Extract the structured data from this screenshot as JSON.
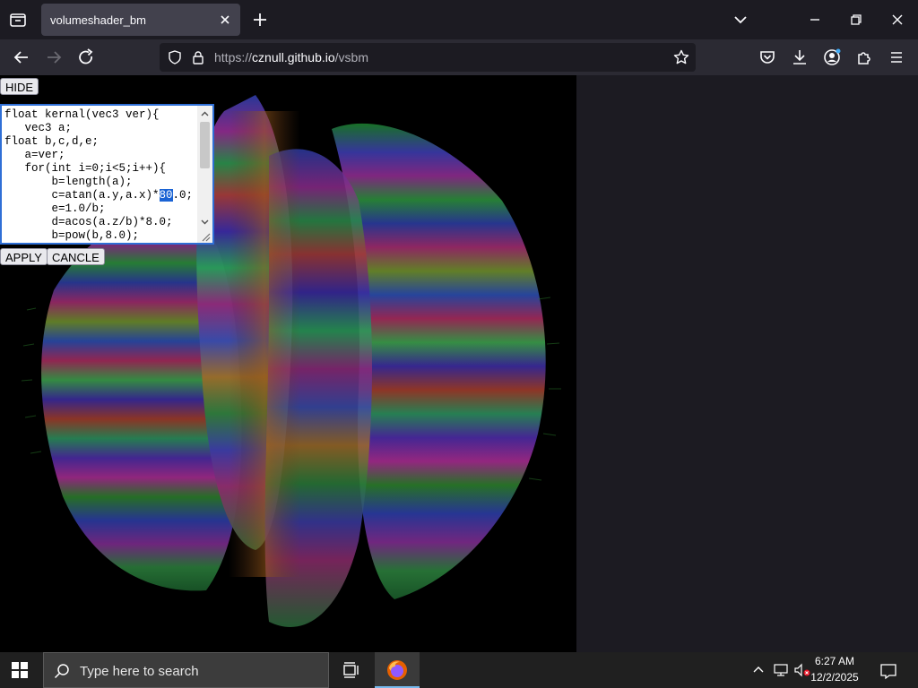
{
  "browser": {
    "tab_title": "volumeshader_bm",
    "url_prefix": "https://",
    "url_host": "cznull.github.io",
    "url_path": "/vsbm"
  },
  "page": {
    "hide_label": "HIDE",
    "apply_label": "APPLY",
    "cancel_label": "CANCLE",
    "code_lines": [
      "float kernal(vec3 ver){",
      "   vec3 a;",
      "float b,c,d,e;",
      "   a=ver;",
      "   for(int i=0;i<5;i++){",
      "       b=length(a);",
      "       c=atan(a.y,a.x)*80.0;",
      "       e=1.0/b;",
      "       d=acos(a.z/b)*8.0;",
      "       b=pow(b,8.0);"
    ],
    "selected_text": "80"
  },
  "taskbar": {
    "search_placeholder": "Type here to search",
    "time": "6:27 AM",
    "date": "12/2/2025"
  },
  "colors": {
    "accent": "#2f6fd6",
    "tab_bg": "#42414d",
    "toolbar_bg": "#2b2a33"
  }
}
